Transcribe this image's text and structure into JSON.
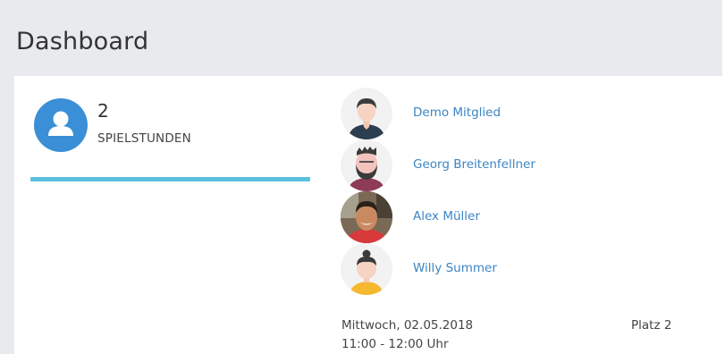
{
  "header": {
    "title": "Dashboard"
  },
  "stats": {
    "count": "2",
    "label": "SPIELSTUNDEN",
    "icon": "user-icon",
    "accent": "#3a8fd6",
    "bar_color": "#5bc0de"
  },
  "members": [
    {
      "name": "Demo Mitglied",
      "avatar": "male-avatar-icon"
    },
    {
      "name": "Georg Breitenfellner",
      "avatar": "bearded-avatar-icon"
    },
    {
      "name": "Alex Müller",
      "avatar": "photo-avatar"
    },
    {
      "name": "Willy Summer",
      "avatar": "female-avatar-icon"
    }
  ],
  "booking": {
    "date": "Mittwoch, 02.05.2018",
    "time": "11:00 - 12:00 Uhr",
    "court": "Platz 2"
  },
  "colors": {
    "link": "#3c85c4",
    "header_bg": "#e8eaed"
  }
}
